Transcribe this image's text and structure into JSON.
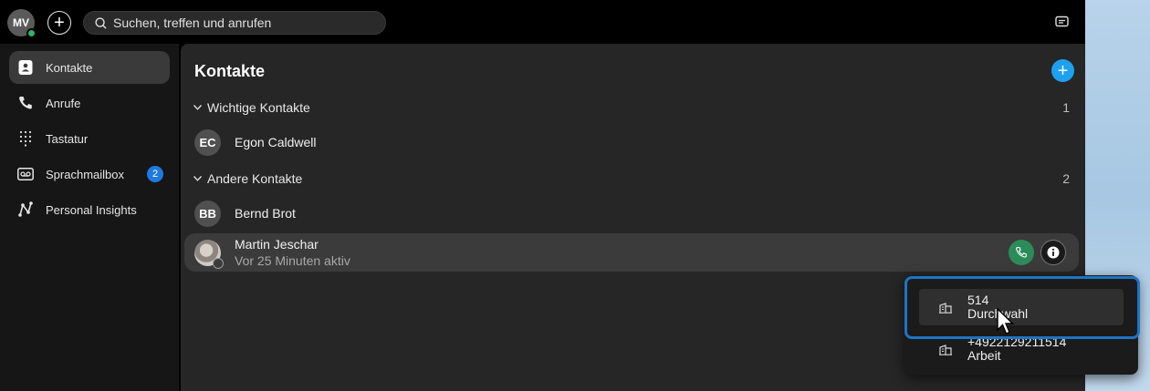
{
  "topbar": {
    "avatar_initials": "MV",
    "add_label": "+",
    "search_placeholder": "Suchen, treffen und anrufen"
  },
  "sidebar": {
    "items": [
      {
        "label": "Kontakte",
        "icon": "contacts-icon",
        "active": true
      },
      {
        "label": "Anrufe",
        "icon": "phone-icon"
      },
      {
        "label": "Tastatur",
        "icon": "dialpad-icon"
      },
      {
        "label": "Sprachmailbox",
        "icon": "voicemail-icon",
        "badge": "2"
      },
      {
        "label": "Personal Insights",
        "icon": "insights-icon"
      }
    ]
  },
  "main": {
    "title": "Kontakte",
    "add_label": "+",
    "groups": [
      {
        "label": "Wichtige Kontakte",
        "count": "1",
        "contacts": [
          {
            "initials": "EC",
            "name": "Egon Caldwell"
          }
        ]
      },
      {
        "label": "Andere Kontakte",
        "count": "2",
        "contacts": [
          {
            "initials": "BB",
            "name": "Bernd Brot"
          },
          {
            "name": "Martin Jeschar",
            "status": "Vor 25 Minuten aktiv"
          }
        ]
      }
    ]
  },
  "dropdown": {
    "items": [
      {
        "number": "514",
        "type": "Durchwahl"
      },
      {
        "number": "+4922129211514",
        "type": "Arbeit"
      }
    ]
  },
  "colors": {
    "accent": "#1ea0f0",
    "call_green": "#2b8c5a",
    "badge_blue": "#1f7ae0",
    "focus_ring": "#1e74c4",
    "presence_green": "#2fb36b"
  }
}
